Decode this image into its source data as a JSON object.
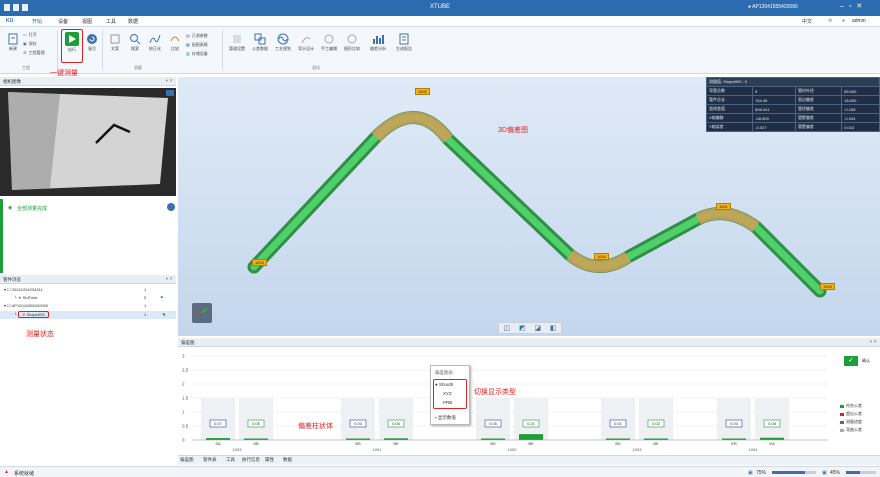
{
  "app": {
    "title": "XTUBE",
    "device": "AP12041555420090",
    "lang": "中文",
    "user": "admin",
    "logo": "KU"
  },
  "menu": [
    "开始",
    "设备",
    "视图",
    "工具",
    "数据"
  ],
  "ribbon": {
    "file": {
      "new": "新建",
      "open": "打开",
      "save": "保存",
      "recent": "工程管理",
      "group": "工程"
    },
    "measure": {
      "run": "执行",
      "reset": "复位",
      "group": "测量"
    },
    "edit": {
      "items": [
        "文案",
        "搜索",
        "校正化",
        "比较"
      ],
      "mini": [
        "已测参数",
        "画图表格",
        "存储设备"
      ]
    },
    "analysis": {
      "items": [
        "管道设置",
        "公差数据",
        "工艺规划",
        "弯头设计",
        "手工编辑",
        "图形比较",
        "偏差分析",
        "生成报告"
      ],
      "group": "测试"
    }
  },
  "camera_panel": {
    "title": "相机图像",
    "status": "全部测量完成"
  },
  "project_panel": {
    "title": "管件浏览",
    "nodes": [
      {
        "label": "20241204234311",
        "count": "1"
      },
      {
        "label": "StdTube",
        "count": "5"
      },
      {
        "label": "AP12041555420090",
        "count": "1"
      },
      {
        "label": "Shape000",
        "count": "1"
      }
    ]
  },
  "view3d": {
    "tags": [
      "1002",
      "1001",
      "1004",
      "1003"
    ],
    "annotation": "3D偏差图"
  },
  "info_table": {
    "header": "测量值: Shape000 : 0",
    "rows": [
      [
        "弯管总数",
        "5",
        "管材外径",
        "55.000"
      ],
      [
        "管件总长",
        "764.45",
        "直边偏差",
        "18.000"
      ],
      [
        "弧线差值",
        "806.041",
        "管径偏差",
        "-0.158"
      ],
      [
        "X轴偏移",
        "-08.009",
        "管壁偏差",
        "-0.034"
      ],
      [
        "Y轴误差",
        "-0.027",
        "管壁偏差",
        "0.016"
      ]
    ]
  },
  "chart_panel": {
    "title": "偏差图",
    "ok_label": "确认",
    "y_ticks": [
      "3",
      "2.5",
      "2",
      "1.5",
      "1",
      "0.5",
      "0"
    ],
    "groups": [
      {
        "label": "1003",
        "segs": [
          {
            "name": "SA",
            "v": "0.07"
          },
          {
            "name": "SB",
            "v": "0.05"
          }
        ]
      },
      {
        "label": "1001",
        "segs": [
          {
            "name": "BS",
            "v": "0.03"
          },
          {
            "name": "BE",
            "v": "0.06"
          }
        ]
      },
      {
        "label": "1002",
        "segs": [
          {
            "name": "BS",
            "v": "0.05"
          },
          {
            "name": "BE",
            "v": "0.21"
          }
        ]
      },
      {
        "label": "1003",
        "segs": [
          {
            "name": "BS",
            "v": "0.01"
          },
          {
            "name": "BE",
            "v": "0.02"
          }
        ]
      },
      {
        "label": "1004",
        "segs": [
          {
            "name": "ER",
            "v": "0.03"
          },
          {
            "name": "EA",
            "v": "0.08"
          }
        ]
      }
    ],
    "legend": [
      "符合公差",
      "超出公差",
      "测量进度",
      "弯曲公差"
    ],
    "context_menu": {
      "title": "偏差图表",
      "items": [
        "Shouth",
        "XYZ",
        "PRB"
      ],
      "footer": "显示数值"
    },
    "bottom_tabs": [
      "偏差图",
      "管件表",
      "工具",
      "执行信息",
      "属性",
      "数据"
    ]
  },
  "annotations": {
    "one_click": "一键测量",
    "state": "测量状态",
    "bars": "偏差柱状体",
    "switch": "切换显示类型"
  },
  "status": {
    "left": "系统就绪",
    "zoom": "75%",
    "pct": "45%"
  },
  "colors": {
    "accent": "#2b6cb0",
    "tube": "#3fbf5a",
    "tube_bend": "#c9a25a",
    "tag": "#f5b21b",
    "annotation": "#d22222"
  }
}
